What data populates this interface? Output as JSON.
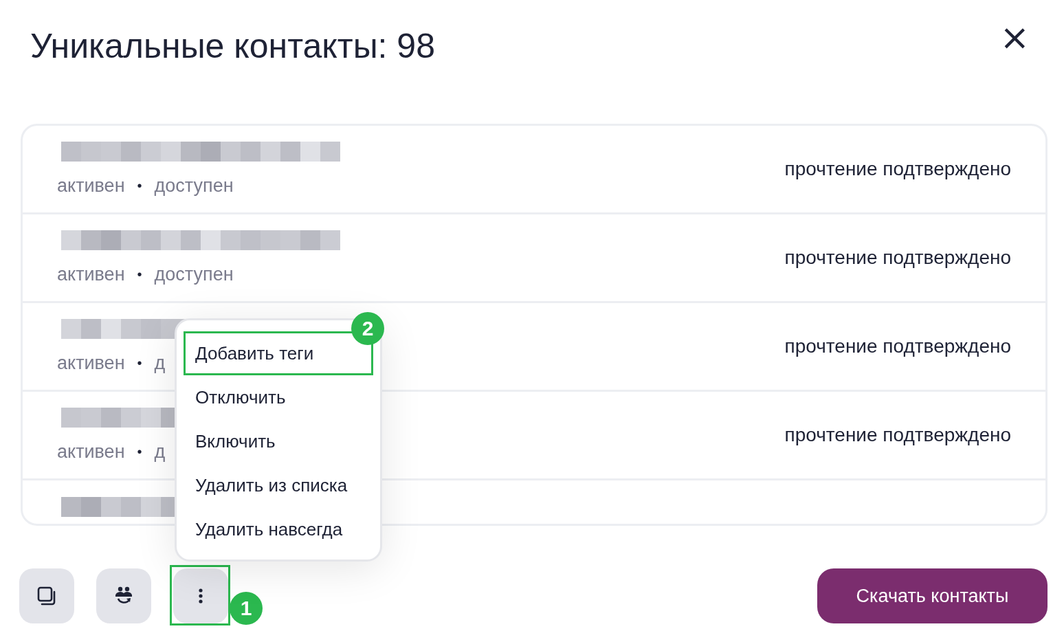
{
  "title": "Уникальные контакты: 98",
  "close_label": "×",
  "contacts": [
    {
      "status": "активен",
      "separator": "•",
      "availability": "доступен",
      "read_status": "прочтение подтверждено"
    },
    {
      "status": "активен",
      "separator": "•",
      "availability": "доступен",
      "read_status": "прочтение подтверждено"
    },
    {
      "status": "активен",
      "separator": "•",
      "availability": "д",
      "read_status": "прочтение подтверждено"
    },
    {
      "status": "активен",
      "separator": "•",
      "availability": "д",
      "read_status": "прочтение подтверждено"
    },
    {
      "kind": "cut-off"
    }
  ],
  "context_menu": {
    "items": [
      {
        "label": "Добавить теги",
        "highlighted": true,
        "annotation": "2"
      },
      {
        "label": "Отключить",
        "highlighted": false
      },
      {
        "label": "Включить",
        "highlighted": false
      },
      {
        "label": "Удалить из списка",
        "highlighted": false
      },
      {
        "label": "Удалить навсегда",
        "highlighted": false
      }
    ]
  },
  "toolbar": [
    {
      "kind": "copy"
    },
    {
      "kind": "group-sync"
    },
    {
      "kind": "more",
      "annotation": "1"
    }
  ],
  "download_button": "Скачать контакты"
}
